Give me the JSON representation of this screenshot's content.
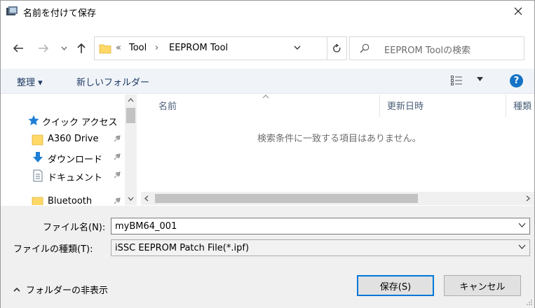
{
  "window": {
    "title": "名前を付けて保存"
  },
  "address": {
    "chevron": "«",
    "segments": [
      "Tool",
      "EEPROM Tool"
    ],
    "separator": "›"
  },
  "search": {
    "placeholder": "EEPROM Toolの検索"
  },
  "toolbar": {
    "organize_label": "整理 ▾",
    "new_folder_label": "新しいフォルダー",
    "help_label": "?"
  },
  "nav_pane": {
    "items": [
      {
        "label": "クイック アクセス",
        "icon": "star-icon"
      },
      {
        "label": "A360 Drive",
        "icon": "folder-icon",
        "pinned": true
      },
      {
        "label": "ダウンロード",
        "icon": "download-arrow-icon",
        "pinned": true
      },
      {
        "label": "ドキュメント",
        "icon": "document-icon",
        "pinned": true
      },
      {
        "label": "Bluetooth",
        "icon": "folder-icon",
        "pinned": true
      }
    ]
  },
  "file_list": {
    "columns": [
      "名前",
      "更新日時",
      "種類"
    ],
    "empty_message": "検索条件に一致する項目はありません。"
  },
  "form": {
    "filename_label": "ファイル名(N):",
    "filename_value": "myBM64_001",
    "filetype_label": "ファイルの種類(T):",
    "filetype_value": "iSSC EEPROM Patch File(*.ipf)"
  },
  "footer": {
    "hide_folders_label": "フォルダーの非表示",
    "save_label": "保存(S)",
    "cancel_label": "キャンセル"
  },
  "colors": {
    "accent": "#0078d7",
    "help": "#1573c5",
    "folder": "#ffd867",
    "star": "#1e7fd6"
  }
}
